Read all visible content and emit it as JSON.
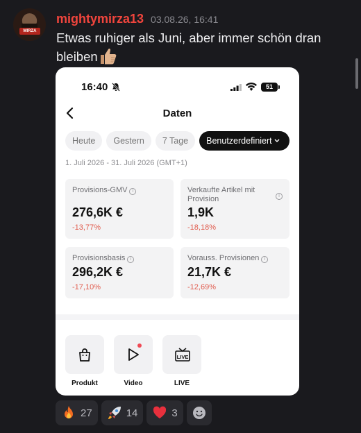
{
  "message": {
    "username": "mightymirza13",
    "timestamp": "03.08.26, 16:41",
    "text": "Etwas ruhiger als Juni, aber immer schön dran bleiben",
    "avatar_tag": "MIRZA"
  },
  "screenshot": {
    "status": {
      "time": "16:40",
      "battery": "51"
    },
    "nav": {
      "title": "Daten"
    },
    "chips": [
      "Heute",
      "Gestern",
      "7 Tage",
      "Benutzerdefiniert"
    ],
    "chip_selected": "Benutzerdefiniert",
    "date_range": "1. Juli 2026 - 31. Juli 2026 (GMT+1)",
    "metrics": [
      {
        "label": "Provisions-GMV",
        "value": "276,6K €",
        "change": "-13,77%"
      },
      {
        "label": "Verkaufte Artikel mit Provision",
        "value": "1,9K",
        "change": "-18,18%"
      },
      {
        "label": "Provisionsbasis",
        "value": "296,2K €",
        "change": "-17,10%"
      },
      {
        "label": "Vorauss. Provisionen",
        "value": "21,7K €",
        "change": "-12,69%"
      }
    ],
    "info_glyph": "i",
    "tools": [
      {
        "label": "Produkt",
        "icon": "bag-icon"
      },
      {
        "label": "Video",
        "icon": "play-icon"
      },
      {
        "label": "LIVE",
        "icon": "live-icon"
      }
    ],
    "colors": {
      "negative_change": "#e15d4f",
      "active_chip": "#111111"
    }
  },
  "reactions": [
    {
      "emoji": "fire-emoji",
      "count": "27"
    },
    {
      "emoji": "rocket-emoji",
      "count": "14"
    },
    {
      "emoji": "heart-emoji",
      "count": "3"
    }
  ],
  "colors": {
    "username": "#f1453d",
    "background": "#1a1a1e"
  }
}
